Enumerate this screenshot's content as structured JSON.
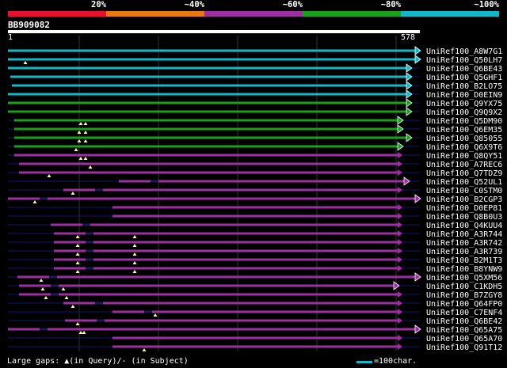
{
  "legend": {
    "colors": [
      "#e8102e",
      "#e87810",
      "#9c30a0",
      "#1aa01a",
      "#10b8c8"
    ],
    "labels": [
      "20%",
      "~40%",
      "~60%",
      "~80%",
      "~100%"
    ]
  },
  "query": {
    "id": "BB909082",
    "start": "1",
    "end": "578"
  },
  "footer": {
    "gaps_text": "Large gaps: ▲(in Query)/- (in Subject)",
    "scale_text": "=100char."
  },
  "hits": [
    {
      "label": "UniRef100_A8W7G1",
      "color": "#10b8c8",
      "start": 10,
      "end": 524,
      "tri": "R",
      "gap": false,
      "marks": []
    },
    {
      "label": "UniRef100_Q50LH7",
      "color": "#10b8c8",
      "start": 10,
      "end": 524,
      "tri": "R",
      "gap": false,
      "marks": [
        32
      ]
    },
    {
      "label": "UniRef100_Q6BE43",
      "color": "#10b8c8",
      "start": 10,
      "end": 513,
      "tri": "R",
      "gap": false,
      "marks": []
    },
    {
      "label": "UniRef100_Q5GHF1",
      "color": "#10b8c8",
      "start": 13,
      "end": 513,
      "tri": "R",
      "gap": false,
      "marks": []
    },
    {
      "label": "UniRef100_B2LO75",
      "color": "#10b8c8",
      "start": 15,
      "end": 513,
      "tri": "R",
      "gap": false,
      "marks": []
    },
    {
      "label": "UniRef100_D0EIN9",
      "color": "#10b8c8",
      "start": 10,
      "end": 513,
      "tri": "R",
      "gap": false,
      "marks": []
    },
    {
      "label": "UniRef100_Q9YX75",
      "color": "#1aa01a",
      "start": 10,
      "end": 513,
      "tri": "R",
      "gap": false,
      "marks": []
    },
    {
      "label": "UniRef100_Q9Q9X2",
      "color": "#1aa01a",
      "start": 10,
      "end": 513,
      "tri": "R",
      "gap": false,
      "marks": []
    },
    {
      "label": "UniRef100_Q5DM90",
      "color": "#1aa01a",
      "start": 18,
      "end": 502,
      "tri": "R",
      "gap": false,
      "marks": [
        102,
        108
      ]
    },
    {
      "label": "UniRef100_Q6EM35",
      "color": "#1aa01a",
      "start": 18,
      "end": 502,
      "tri": "R",
      "gap": false,
      "marks": [
        100,
        108
      ]
    },
    {
      "label": "UniRef100_Q85055",
      "color": "#1aa01a",
      "start": 18,
      "end": 513,
      "tri": "R",
      "gap": false,
      "marks": [
        100,
        108
      ]
    },
    {
      "label": "UniRef100_Q6X9T6",
      "color": "#1aa01a",
      "start": 18,
      "end": 502,
      "tri": "R",
      "gap": false,
      "marks": [
        96
      ]
    },
    {
      "label": "UniRef100_Q8QY51",
      "color": "#9c30a0",
      "start": 18,
      "end": 502,
      "tri": "N",
      "gap": false,
      "marks": [
        102,
        108
      ]
    },
    {
      "label": "UniRef100_A7REC6",
      "color": "#9c30a0",
      "start": 24,
      "end": 502,
      "tri": "N",
      "gap": false,
      "marks": [
        114
      ]
    },
    {
      "label": "UniRef100_Q7TDZ9",
      "color": "#9c30a0",
      "start": 24,
      "end": 502,
      "tri": "N",
      "gap": false,
      "marks": [
        62
      ]
    },
    {
      "label": "UniRef100_Q52UL1",
      "color": "#9c30a0",
      "start": 150,
      "end": 510,
      "tri": "R",
      "gap": true,
      "marks": []
    },
    {
      "label": "UniRef100_C0STM0",
      "color": "#9c30a0",
      "start": 80,
      "end": 502,
      "tri": "N",
      "gap": true,
      "marks": [
        92
      ]
    },
    {
      "label": "UniRef100_B2CGP3",
      "color": "#9c30a0",
      "start": 10,
      "end": 524,
      "tri": "R",
      "gap": true,
      "marks": [
        44
      ]
    },
    {
      "label": "UniRef100_D0EP81",
      "color": "#9c30a0",
      "start": 142,
      "end": 502,
      "tri": "N",
      "gap": false,
      "marks": []
    },
    {
      "label": "UniRef100_Q8B0U3",
      "color": "#9c30a0",
      "start": 142,
      "end": 502,
      "tri": "N",
      "gap": false,
      "marks": []
    },
    {
      "label": "UniRef100_Q4KUU4",
      "color": "#9c30a0",
      "start": 64,
      "end": 502,
      "tri": "N",
      "gap": true,
      "marks": []
    },
    {
      "label": "UniRef100_A3R744",
      "color": "#9c30a0",
      "start": 68,
      "end": 502,
      "tri": "N",
      "gap": true,
      "marks": [
        98,
        170
      ]
    },
    {
      "label": "UniRef100_A3R742",
      "color": "#9c30a0",
      "start": 68,
      "end": 502,
      "tri": "N",
      "gap": true,
      "marks": [
        98,
        170
      ]
    },
    {
      "label": "UniRef100_A3R739",
      "color": "#9c30a0",
      "start": 68,
      "end": 502,
      "tri": "N",
      "gap": true,
      "marks": [
        98,
        170
      ]
    },
    {
      "label": "UniRef100_B2M1T3",
      "color": "#9c30a0",
      "start": 68,
      "end": 502,
      "tri": "N",
      "gap": true,
      "marks": [
        98,
        170
      ]
    },
    {
      "label": "UniRef100_B8YNW9",
      "color": "#9c30a0",
      "start": 68,
      "end": 502,
      "tri": "N",
      "gap": true,
      "marks": [
        98,
        170
      ]
    },
    {
      "label": "UniRef100_Q5XM56",
      "color": "#9c30a0",
      "start": 22,
      "end": 524,
      "tri": "R",
      "gap": true,
      "marks": [
        52
      ]
    },
    {
      "label": "UniRef100_C1KDH5",
      "color": "#9c30a0",
      "start": 24,
      "end": 497,
      "tri": "R",
      "gap": true,
      "marks": [
        54,
        80
      ]
    },
    {
      "label": "UniRef100_B7ZGY8",
      "color": "#9c30a0",
      "start": 24,
      "end": 502,
      "tri": "N",
      "gap": true,
      "marks": [
        58,
        84
      ]
    },
    {
      "label": "UniRef100_Q64FP0",
      "color": "#9c30a0",
      "start": 80,
      "end": 502,
      "tri": "N",
      "gap": true,
      "marks": [
        92
      ]
    },
    {
      "label": "UniRef100_C7ENF4",
      "color": "#9c30a0",
      "start": 142,
      "end": 502,
      "tri": "N",
      "gap": true,
      "marks": [
        196
      ]
    },
    {
      "label": "UniRef100_Q6BE42",
      "color": "#9c30a0",
      "start": 82,
      "end": 502,
      "tri": "N",
      "gap": true,
      "marks": [
        98
      ]
    },
    {
      "label": "UniRef100_Q65A75",
      "color": "#9c30a0",
      "start": 10,
      "end": 524,
      "tri": "R",
      "gap": true,
      "marks": [
        102,
        106
      ]
    },
    {
      "label": "UniRef100_Q65A70",
      "color": "#9c30a0",
      "start": 142,
      "end": 502,
      "tri": "N",
      "gap": false,
      "marks": []
    },
    {
      "label": "UniRef100_Q91T12",
      "color": "#9c30a0",
      "start": 142,
      "end": 502,
      "tri": "N",
      "gap": false,
      "marks": [
        182
      ]
    }
  ]
}
